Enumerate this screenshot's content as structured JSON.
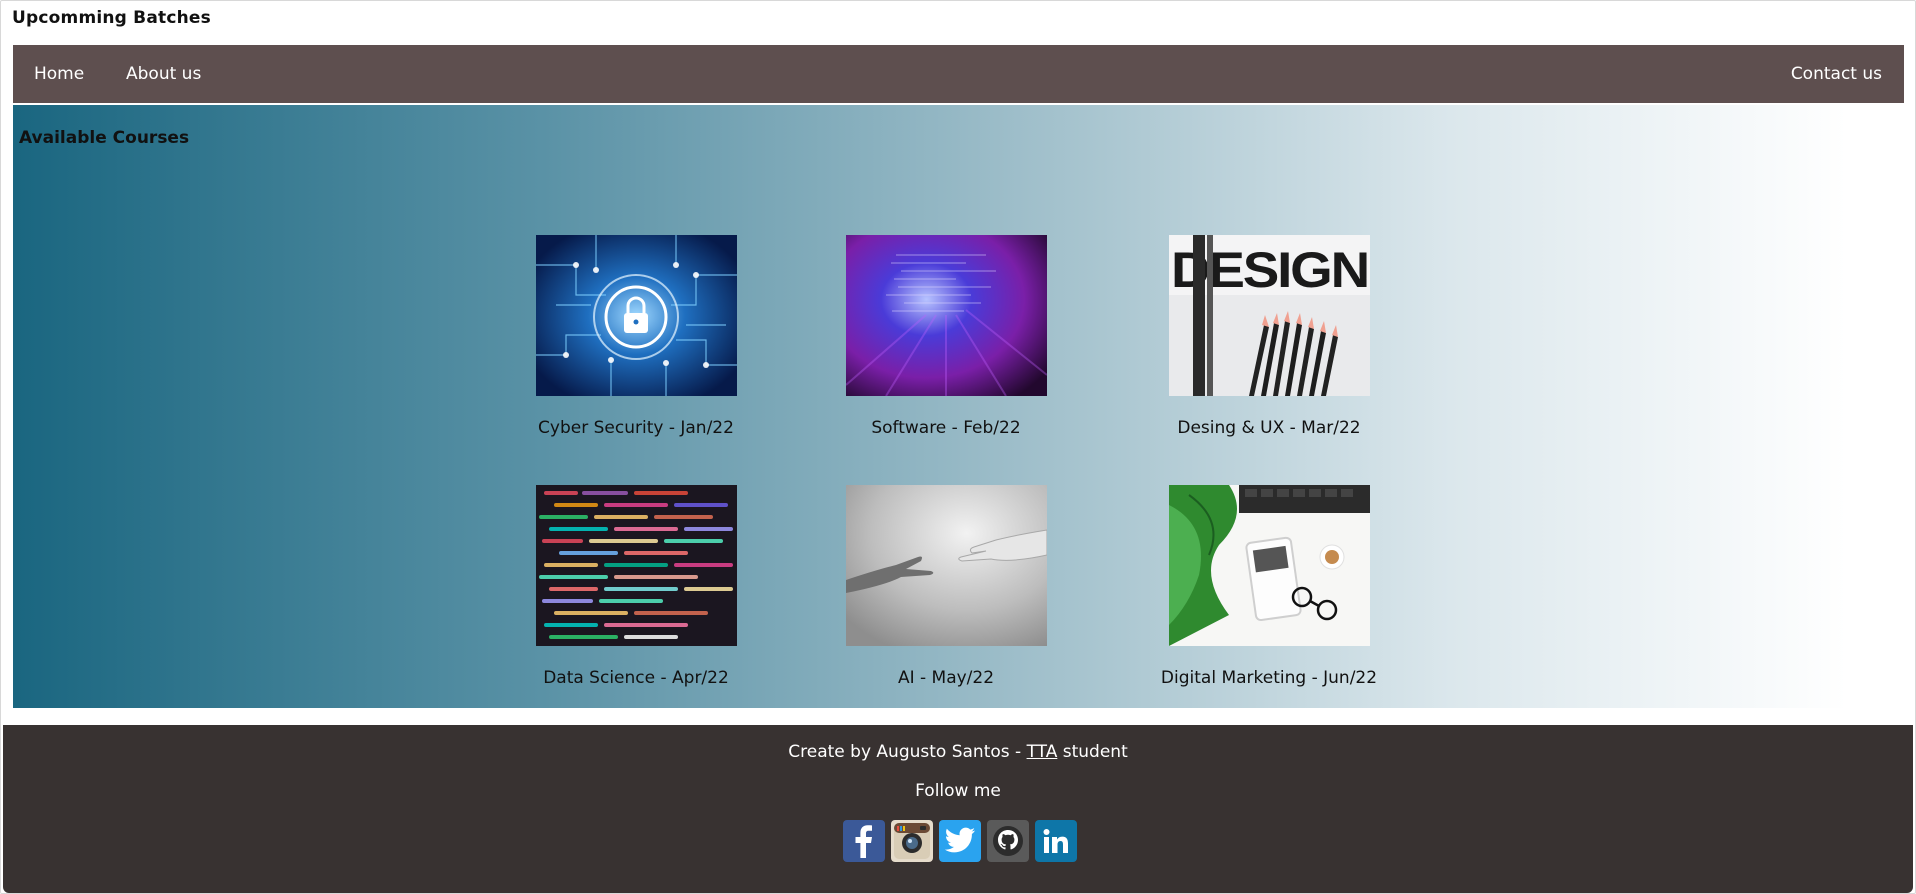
{
  "site": {
    "title": "Upcomming Batches"
  },
  "nav": {
    "home": "Home",
    "about": "About us",
    "contact": "Contact us"
  },
  "courses": {
    "title": "Available Courses",
    "items": [
      {
        "label": "Cyber Security - Jan/22",
        "image": "padlock-circuit-board-image"
      },
      {
        "label": "Software - Feb/22",
        "image": "blurred-code-screen-image"
      },
      {
        "label": "Desing & UX - Mar/22",
        "image": "design-pencils-image"
      },
      {
        "label": "Data Science - Apr/22",
        "image": "colorful-code-image"
      },
      {
        "label": "AI - May/22",
        "image": "human-robot-hands-image"
      },
      {
        "label": "Digital Marketing - Jun/22",
        "image": "tablet-desk-plant-image"
      }
    ]
  },
  "footer": {
    "credit_prefix": "Create by Augusto Santos - ",
    "credit_link": "TTA",
    "credit_suffix": " student",
    "follow": "Follow me",
    "socials": [
      "facebook-icon",
      "instagram-icon",
      "twitter-icon",
      "github-icon",
      "linkedin-icon"
    ]
  },
  "colors": {
    "navbar": "#5e4f4f",
    "footer": "#383231",
    "gradient_start": "#1a6680",
    "gradient_end": "#ffffff"
  }
}
